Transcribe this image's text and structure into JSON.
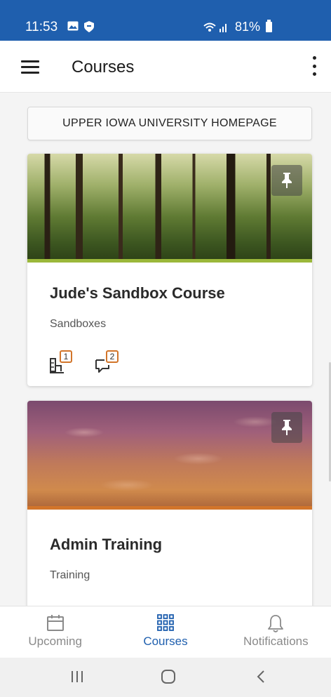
{
  "status_bar": {
    "time": "11:53",
    "battery": "81%"
  },
  "app_bar": {
    "title": "Courses"
  },
  "homepage_link": {
    "label": "UPPER IOWA UNIVERSITY HOMEPAGE"
  },
  "courses": [
    {
      "title": "Jude's Sandbox Course",
      "category": "Sandboxes",
      "accent_color": "#9bb83a",
      "assignments_count": "1",
      "discussions_count": "2"
    },
    {
      "title": "Admin Training",
      "category": "Training",
      "accent_color": "#d2752a"
    }
  ],
  "bottom_nav": {
    "items": [
      {
        "label": "Upcoming",
        "icon": "calendar-icon",
        "active": false
      },
      {
        "label": "Courses",
        "icon": "grid-icon",
        "active": true
      },
      {
        "label": "Notifications",
        "icon": "bell-icon",
        "active": false
      }
    ]
  },
  "colors": {
    "brand": "#1f5fae",
    "badge": "#d2752a"
  }
}
